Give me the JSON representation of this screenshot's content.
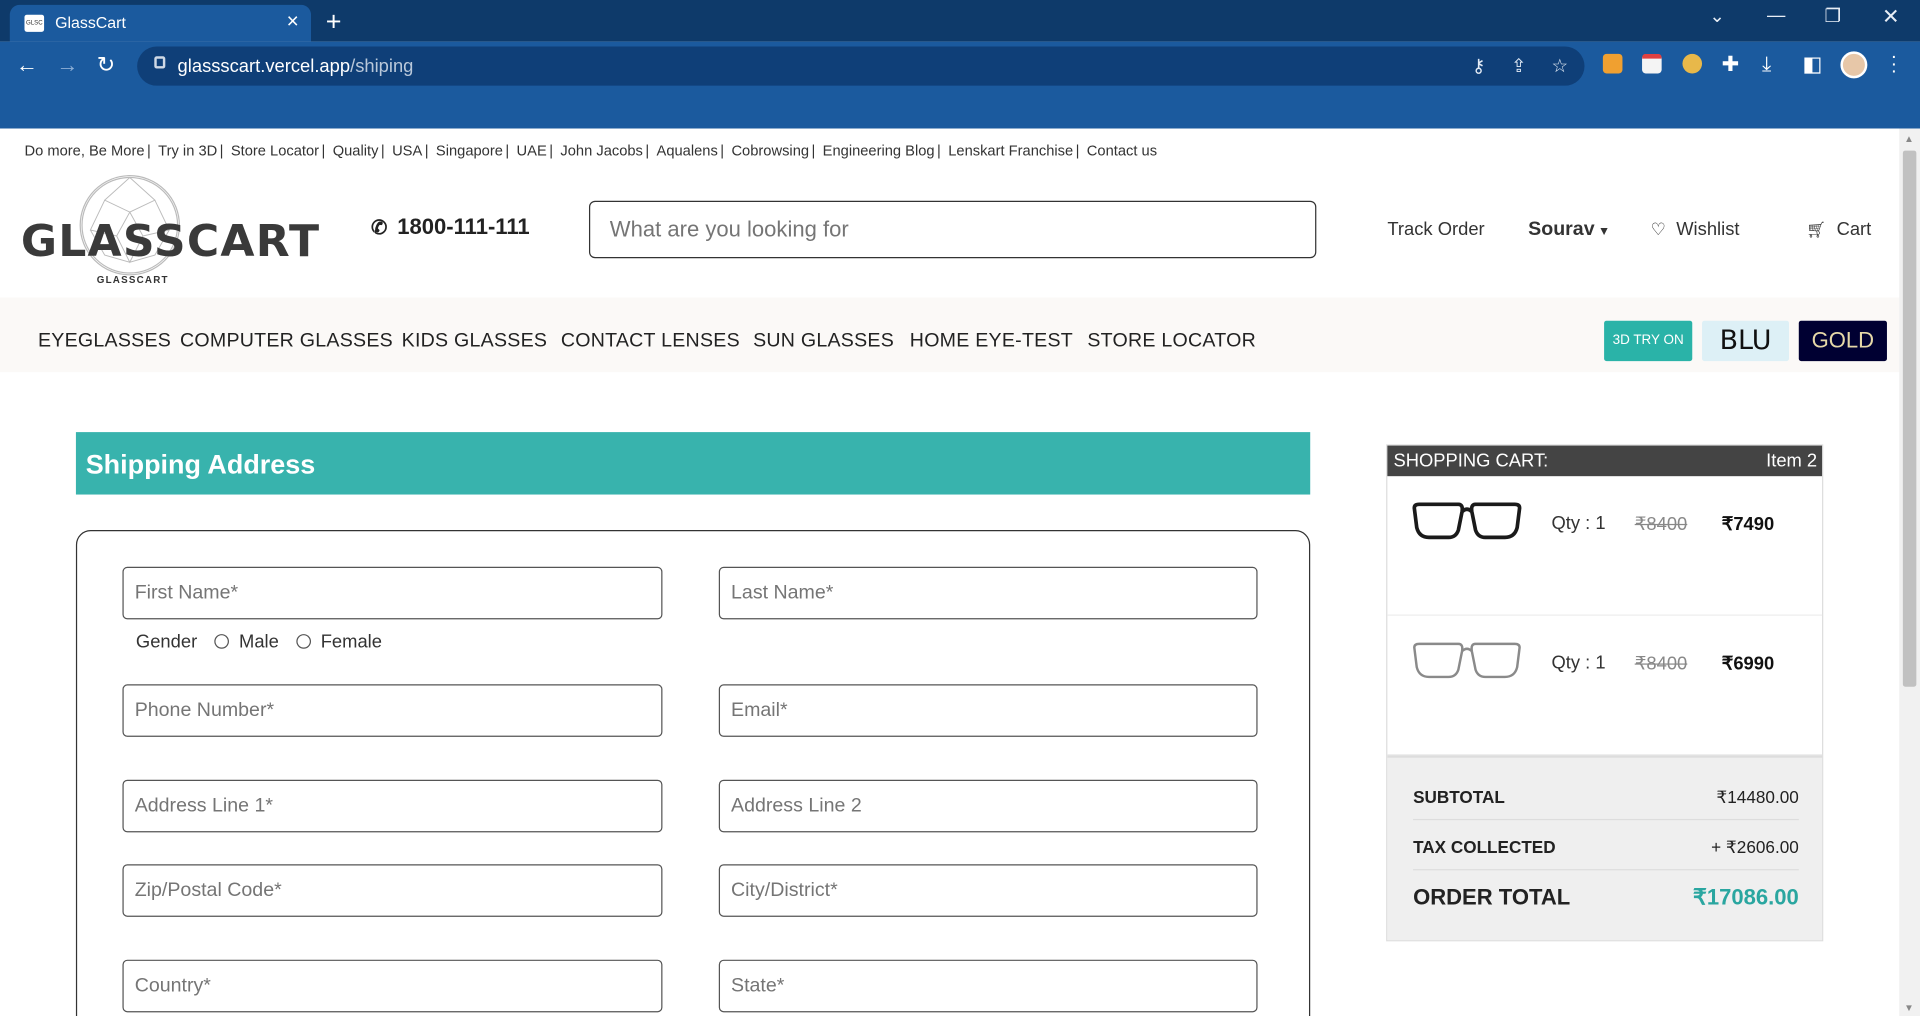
{
  "browser": {
    "tab_title": "GlassCart",
    "favicon_text": "GLSC",
    "url_host": "glassscart.vercel.app",
    "url_path": "/shiping"
  },
  "top_links": [
    "Do more, Be More",
    "Try in 3D",
    "Store Locator",
    "Quality",
    "USA",
    "Singapore",
    "UAE",
    "John Jacobs",
    "Aqualens",
    "Cobrowsing",
    "Engineering Blog",
    "Lenskart Franchise",
    "Contact us"
  ],
  "header": {
    "logo_text": "GLASSCART",
    "logo_subtext": "GLASSCART",
    "phone": "1800-111-111",
    "search_placeholder": "What are you looking for",
    "track_order": "Track Order",
    "user_name": "Sourav",
    "wishlist": "Wishlist",
    "cart": "Cart"
  },
  "categories": [
    "EYEGLASSES",
    "COMPUTER GLASSES",
    "KIDS GLASSES",
    "CONTACT LENSES",
    "SUN GLASSES",
    "HOME EYE-TEST",
    "STORE LOCATOR"
  ],
  "promo": {
    "try3d": "3D TRY ON",
    "blu": "BLU",
    "gold": "GOLD"
  },
  "shipping": {
    "title": "Shipping Address",
    "first_name": "First Name*",
    "last_name": "Last Name*",
    "gender_label": "Gender",
    "male": "Male",
    "female": "Female",
    "phone": "Phone Number*",
    "email": "Email*",
    "address1": "Address Line 1*",
    "address2": "Address Line 2",
    "zip": "Zip/Postal Code*",
    "city": "City/District*",
    "country": "Country*",
    "state": "State*"
  },
  "cart": {
    "title": "SHOPPING CART:",
    "count": "Item 2",
    "items": [
      {
        "qty": "Qty : 1",
        "old_price": "₹8400",
        "price": "₹7490",
        "frame_color": "#1a1a1a"
      },
      {
        "qty": "Qty : 1",
        "old_price": "₹8400",
        "price": "₹6990",
        "frame_color": "#8a8a8a"
      }
    ],
    "subtotal_label": "SUBTOTAL",
    "subtotal": "₹14480.00",
    "tax_label": "TAX COLLECTED",
    "tax": "+ ₹2606.00",
    "total_label": "ORDER TOTAL",
    "total": "₹17086.00",
    "total_color": "#2aa6a0"
  }
}
